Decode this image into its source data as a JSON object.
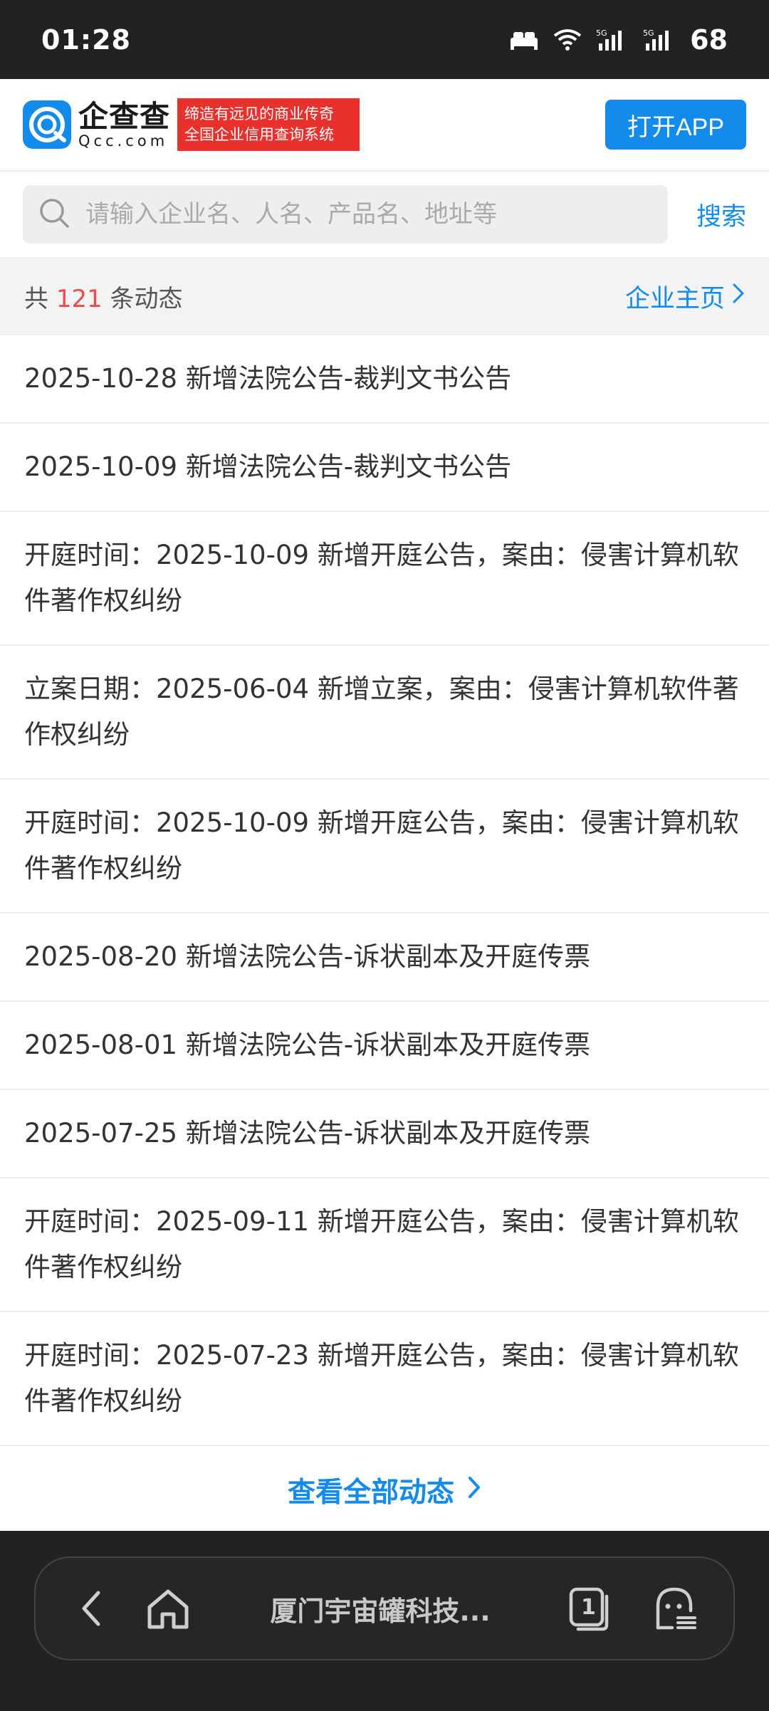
{
  "status_bar": {
    "time": "01:28",
    "battery": "68",
    "icons": [
      "bed-icon",
      "wifi-icon",
      "signal-5g-icon",
      "signal-5g-icon"
    ]
  },
  "header": {
    "logo_cn": "企查查",
    "logo_en": "Qcc.com",
    "slogan_line1": "缔造有远见的商业传奇",
    "slogan_line2": "全国企业信用查询系统",
    "open_app_label": "打开APP",
    "colors": {
      "brand_blue": "#128bed",
      "slogan_red": "#e8312c"
    }
  },
  "search": {
    "placeholder": "请输入企业名、人名、产品名、地址等",
    "button_label": "搜索"
  },
  "summary": {
    "prefix": "共",
    "count": "121",
    "suffix": "条动态",
    "company_link_label": "企业主页"
  },
  "feed": {
    "items": [
      {
        "text": "2025-10-28 新增法院公告-裁判文书公告"
      },
      {
        "text": "2025-10-09 新增法院公告-裁判文书公告"
      },
      {
        "text": "开庭时间：2025-10-09 新增开庭公告，案由：侵害计算机软件著作权纠纷"
      },
      {
        "text": "立案日期：2025-06-04 新增立案，案由：侵害计算机软件著作权纠纷"
      },
      {
        "text": "开庭时间：2025-10-09 新增开庭公告，案由：侵害计算机软件著作权纠纷"
      },
      {
        "text": "2025-08-20 新增法院公告-诉状副本及开庭传票"
      },
      {
        "text": "2025-08-01 新增法院公告-诉状副本及开庭传票"
      },
      {
        "text": "2025-07-25 新增法院公告-诉状副本及开庭传票"
      },
      {
        "text": "开庭时间：2025-09-11 新增开庭公告，案由：侵害计算机软件著作权纠纷"
      },
      {
        "text": "开庭时间：2025-07-23 新增开庭公告，案由：侵害计算机软件著作权纠纷"
      }
    ]
  },
  "view_all_label": "查看全部动态",
  "browser_bar": {
    "title": "厦门宇宙罐科技...",
    "tab_count": "1",
    "icons": [
      "back-icon",
      "home-icon",
      "tabs-icon",
      "menu-icon"
    ]
  }
}
